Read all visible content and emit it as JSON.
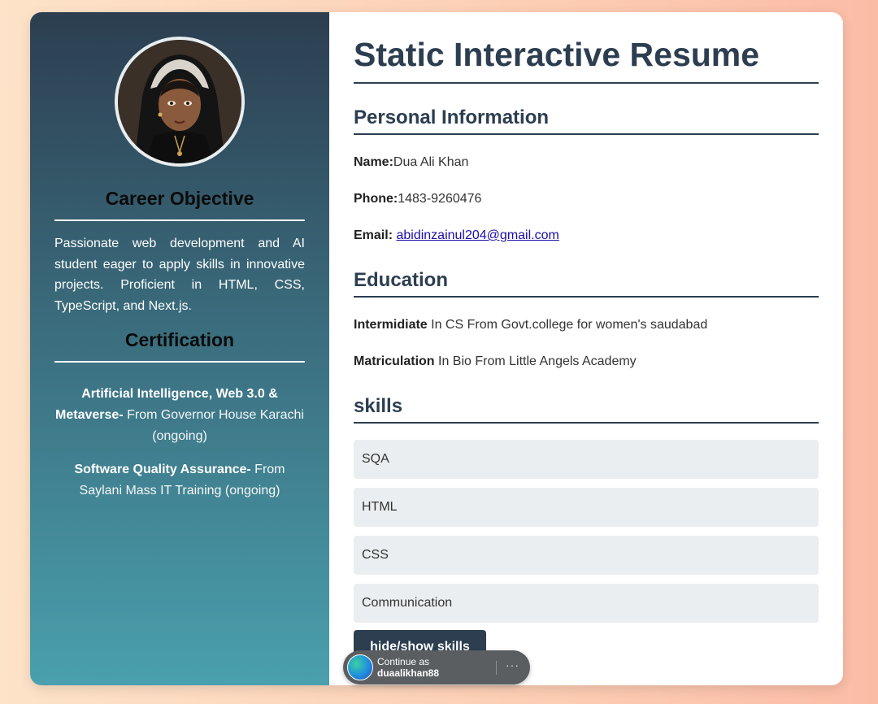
{
  "sidebar": {
    "career_heading": "Career Objective",
    "objective": "Passionate web development and AI student eager to apply skills in innovative projects. Proficient in HTML, CSS, TypeScript, and Next.js.",
    "cert_heading": "Certification",
    "certifications": [
      {
        "title": "Artificial Intelligence, Web 3.0 & Metaverse-",
        "detail": " From Governor House Karachi (ongoing)"
      },
      {
        "title": "Software Quality Assurance-",
        "detail": " From Saylani Mass IT Training (ongoing)"
      }
    ]
  },
  "main": {
    "title": "Static Interactive Resume",
    "personal": {
      "heading": "Personal Information",
      "name_label": "Name:",
      "name_value": "Dua Ali Khan",
      "phone_label": "Phone:",
      "phone_value": "1483-9260476",
      "email_label": "Email:",
      "email_value": "abidinzainul204@gmail.com"
    },
    "education": {
      "heading": "Education",
      "items": [
        {
          "label": "Intermidiate",
          "detail": " In CS From Govt.college for women's saudabad"
        },
        {
          "label": "Matriculation",
          "detail": " In Bio From Little Angels Academy"
        }
      ]
    },
    "skills": {
      "heading": "skills",
      "items": [
        "SQA",
        "HTML",
        "CSS",
        "Communication"
      ],
      "toggle_label": "hide/show skills"
    }
  },
  "continue_prompt": {
    "line1": "Continue as",
    "username": "duaalikhan88",
    "more": "···"
  },
  "colors": {
    "primary": "#2c3e50",
    "sidebar_top": "#2c3e50",
    "sidebar_bottom": "#4aa0ae",
    "skill_bg": "#ebeef0",
    "link": "#1a0dab"
  }
}
